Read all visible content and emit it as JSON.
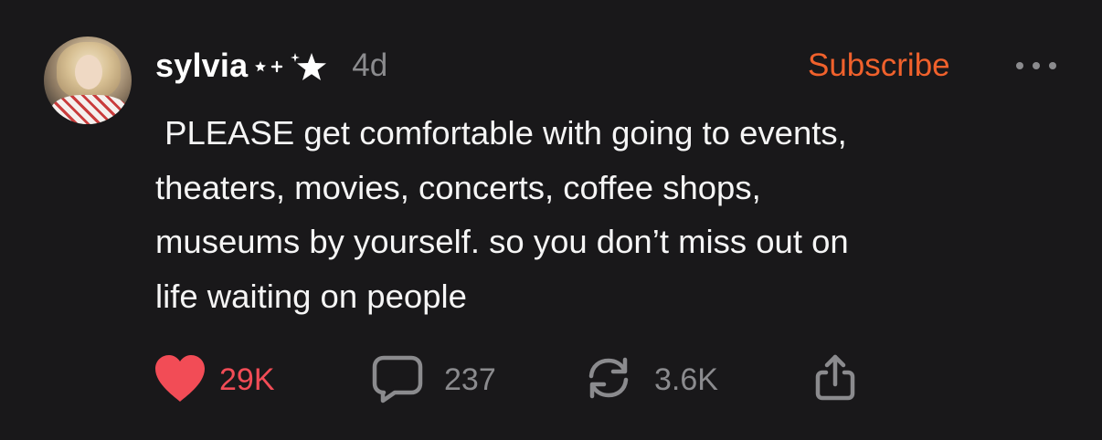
{
  "post": {
    "author": "sylvia",
    "time": "4d",
    "subscribe_label": "Subscribe",
    "text": " PLEASE get comfortable with going to events,\ntheaters, movies, concerts, coffee shops,\nmuseums by yourself. so you don’t miss out on\nlife waiting on people",
    "likes": "29K",
    "comments": "237",
    "reposts": "3.6K"
  },
  "icons": {
    "more": "ellipsis-icon",
    "like": "heart-icon",
    "comment": "speech-bubble-icon",
    "repost": "refresh-icon",
    "share": "share-icon",
    "decoration": "sparkle-stars-icon"
  },
  "colors": {
    "background": "#19181a",
    "accent": "#f0612c",
    "like": "#f24c56",
    "muted": "#8b8b8e",
    "text": "#ffffff"
  }
}
